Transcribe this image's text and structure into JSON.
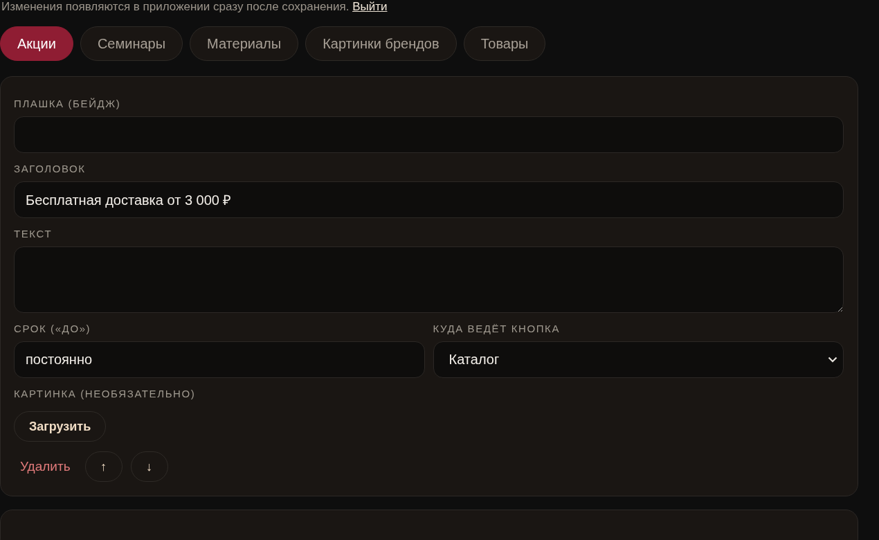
{
  "notice": {
    "text": "Изменения появляются в приложении сразу после сохранения.",
    "link": "Выйти"
  },
  "tabs": [
    {
      "label": "Акции",
      "selected": true
    },
    {
      "label": "Семинары",
      "selected": false
    },
    {
      "label": "Материалы",
      "selected": false
    },
    {
      "label": "Картинки брендов",
      "selected": false
    },
    {
      "label": "Товары",
      "selected": false
    }
  ],
  "card": {
    "fields": [
      {
        "kind": "input",
        "label": "ПЛАШКА (БЕЙДЖ)"
      },
      {
        "kind": "input",
        "label": "ЗАГОЛОВОК",
        "value": "Бесплатная доставка от 3 000 ₽"
      },
      {
        "kind": "textarea",
        "label": "ТЕКСТ"
      }
    ],
    "row": [
      {
        "kind": "input",
        "label": "СРОК («ДО»)",
        "value": "постоянно"
      },
      {
        "kind": "select",
        "label": "КУДА ВЕДЁТ КНОПКА",
        "value": "Каталог"
      }
    ],
    "image": {
      "label": "КАРТИНКА (НЕОБЯЗАТЕЛЬНО)",
      "button": "Загрузить"
    },
    "actions": {
      "delete": "Удалить",
      "up": "↑",
      "down": "↓"
    }
  }
}
